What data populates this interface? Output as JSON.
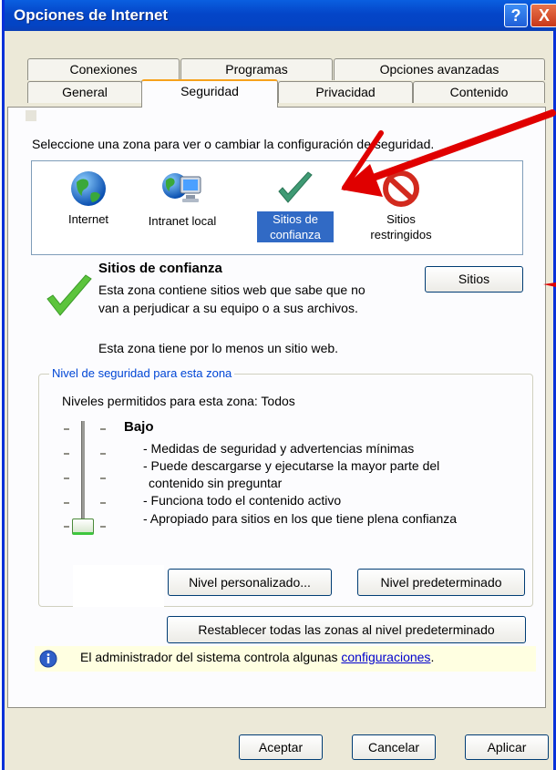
{
  "window": {
    "title": "Opciones de Internet",
    "help_glyph": "?",
    "close_glyph": "X"
  },
  "tabs": {
    "row1": [
      "Conexiones",
      "Programas",
      "Opciones avanzadas"
    ],
    "row2": [
      "General",
      "Seguridad",
      "Privacidad",
      "Contenido"
    ],
    "active": "Seguridad"
  },
  "security": {
    "instruction": "Seleccione una zona para ver o cambiar la configuración de seguridad.",
    "zones": [
      {
        "name": "Internet",
        "icon": "globe-icon"
      },
      {
        "name": "Intranet local",
        "icon": "intranet-icon"
      },
      {
        "name": "Sitios de confianza",
        "icon": "checkmark-icon",
        "selected": true
      },
      {
        "name": "Sitios restringidos",
        "icon": "restricted-icon"
      }
    ],
    "zone_title": "Sitios de confianza",
    "zone_desc_1": "Esta zona contiene sitios web que sabe que no",
    "zone_desc_2": "van a perjudicar a su equipo o a sus archivos.",
    "zone_note": "Esta zona tiene por lo menos un sitio web.",
    "sites_button": "Sitios"
  },
  "level_group": {
    "label": "Nivel de seguridad para esta zona",
    "allowed": "Niveles permitidos para esta zona: Todos",
    "level_name": "Bajo",
    "bullets": [
      "- Medidas de seguridad y advertencias mínimas",
      "- Puede descargarse y ejecutarse la mayor parte del",
      "contenido sin preguntar",
      "- Funciona todo el contenido activo",
      "- Apropiado para sitios en los que tiene plena confianza"
    ],
    "custom_button": "Nivel personalizado...",
    "default_button": "Nivel predeterminado"
  },
  "reset_button": "Restablecer todas las zonas al nivel predeterminado",
  "info": {
    "text": "El administrador del sistema controla algunas ",
    "link": "configuraciones",
    "suffix": "."
  },
  "footer": {
    "ok": "Aceptar",
    "cancel": "Cancelar",
    "apply": "Aplicar"
  },
  "colors": {
    "title_bar": "#0445c8",
    "selection": "#316ac5",
    "annotation_arrow": "#e00000",
    "tab_highlight": "#f6a21c"
  }
}
